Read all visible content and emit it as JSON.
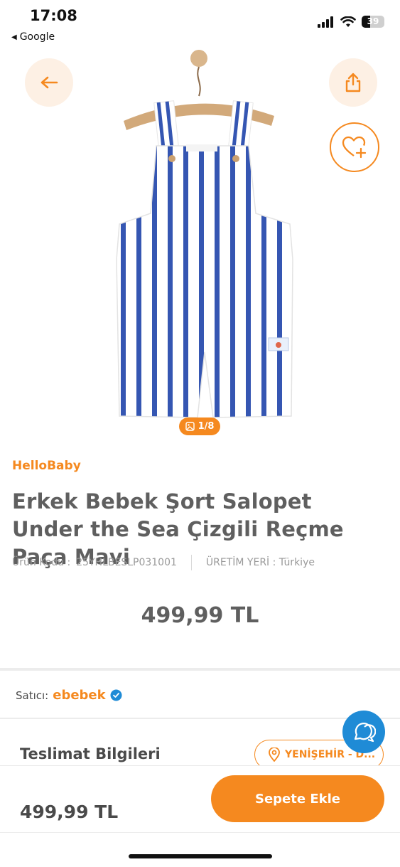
{
  "status_bar": {
    "time": "17:08",
    "back_app": "Google",
    "battery": "39"
  },
  "image": {
    "counter": "1/8"
  },
  "product": {
    "brand": "HelloBaby",
    "title": "Erkek Bebek Şort Salopet Under the Sea Çizgili Reçme Paça Mavi",
    "code_label": "Ürün Kodu :",
    "code_value": "25YHLBESLP031001",
    "origin": "ÜRETİM YERİ : Türkiye",
    "price": "499,99 TL"
  },
  "seller": {
    "label": "Satıcı:",
    "name": "ebebek"
  },
  "delivery": {
    "title": "Teslimat Bilgileri",
    "location": "YENİŞEHİR - D..."
  },
  "bottom_bar": {
    "price": "499,99 TL",
    "cart_button": "Sepete Ekle"
  },
  "colors": {
    "accent": "#f5891f",
    "chat": "#1f8bd6",
    "stripe": "#3556b2"
  },
  "icons": [
    "back-arrow-icon",
    "share-icon",
    "heart-plus-icon",
    "image-icon",
    "verified-icon",
    "location-pin-icon",
    "chat-icon"
  ]
}
